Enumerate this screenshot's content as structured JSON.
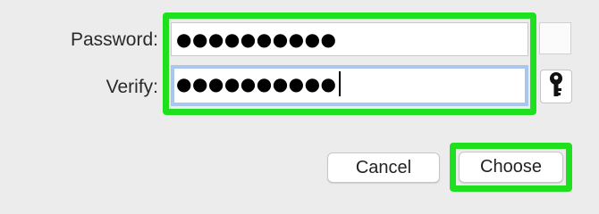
{
  "form": {
    "password_label": "Password:",
    "verify_label": "Verify:",
    "password_value": "●●●●●●●●●●",
    "verify_value": "●●●●●●●●●●"
  },
  "key_button": {
    "icon": "key-icon"
  },
  "buttons": {
    "cancel": "Cancel",
    "choose": "Choose"
  },
  "colors": {
    "highlight": "#1ee01e",
    "focus_ring": "#a9c7ee"
  }
}
